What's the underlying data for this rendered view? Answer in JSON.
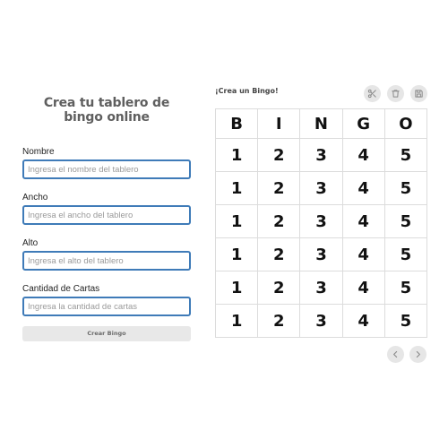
{
  "form": {
    "title": "Crea tu tablero de bingo online",
    "fields": [
      {
        "label": "Nombre",
        "placeholder": "Ingresa el nombre del tablero",
        "value": ""
      },
      {
        "label": "Ancho",
        "placeholder": "Ingresa el ancho del tablero",
        "value": ""
      },
      {
        "label": "Alto",
        "placeholder": "Ingresa el alto del tablero",
        "value": ""
      },
      {
        "label": "Cantidad de Cartas",
        "placeholder": "Ingresa la cantidad de cartas",
        "value": ""
      }
    ],
    "submit_label": "Crear Bingo"
  },
  "board": {
    "title": "¡Crea un Bingo!",
    "tools": [
      "scissors-icon",
      "trash-icon",
      "save-icon"
    ],
    "headers": [
      "B",
      "I",
      "N",
      "G",
      "O"
    ],
    "rows": [
      [
        "1",
        "2",
        "3",
        "4",
        "5"
      ],
      [
        "1",
        "2",
        "3",
        "4",
        "5"
      ],
      [
        "1",
        "2",
        "3",
        "4",
        "5"
      ],
      [
        "1",
        "2",
        "3",
        "4",
        "5"
      ],
      [
        "1",
        "2",
        "3",
        "4",
        "5"
      ],
      [
        "1",
        "2",
        "3",
        "4",
        "5"
      ]
    ],
    "nav": [
      "chevron-left-icon",
      "chevron-right-icon"
    ]
  },
  "colors": {
    "input_border": "#3f7bb8",
    "button_bg": "#e8e8e8",
    "title": "#5f5f5f"
  }
}
